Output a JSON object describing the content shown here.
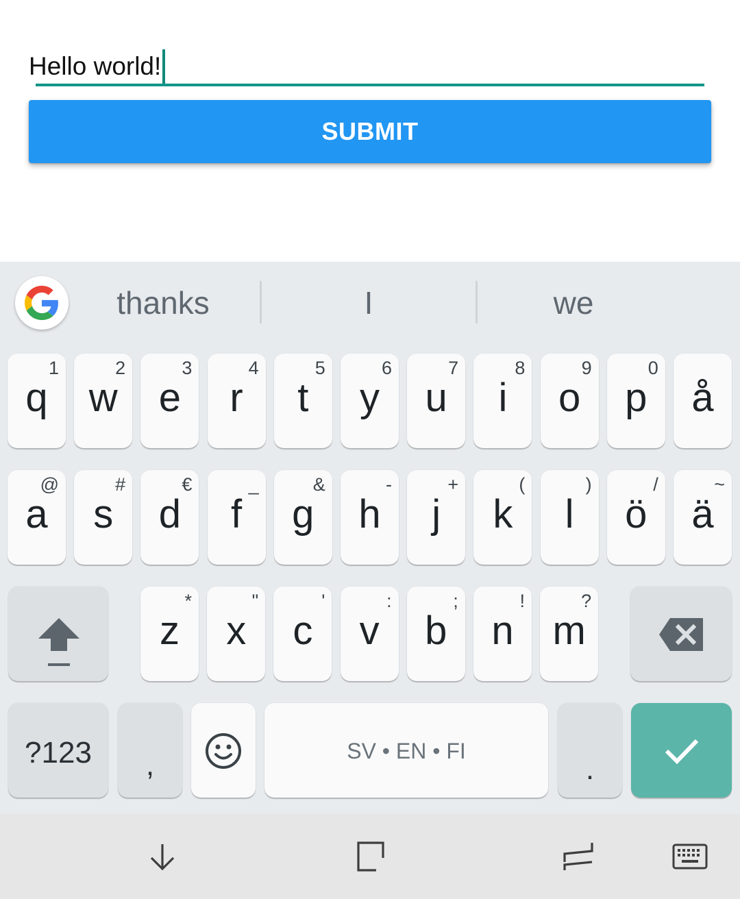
{
  "app": {
    "input_value": "Hello world!",
    "submit_label": "SUBMIT"
  },
  "keyboard": {
    "suggestions": [
      "thanks",
      "I",
      "we"
    ],
    "row1": [
      {
        "key": "q",
        "hint": "1"
      },
      {
        "key": "w",
        "hint": "2"
      },
      {
        "key": "e",
        "hint": "3"
      },
      {
        "key": "r",
        "hint": "4"
      },
      {
        "key": "t",
        "hint": "5"
      },
      {
        "key": "y",
        "hint": "6"
      },
      {
        "key": "u",
        "hint": "7"
      },
      {
        "key": "i",
        "hint": "8"
      },
      {
        "key": "o",
        "hint": "9"
      },
      {
        "key": "p",
        "hint": "0"
      },
      {
        "key": "å",
        "hint": ""
      }
    ],
    "row2": [
      {
        "key": "a",
        "hint": "@"
      },
      {
        "key": "s",
        "hint": "#"
      },
      {
        "key": "d",
        "hint": "€"
      },
      {
        "key": "f",
        "hint": "_"
      },
      {
        "key": "g",
        "hint": "&"
      },
      {
        "key": "h",
        "hint": "-"
      },
      {
        "key": "j",
        "hint": "+"
      },
      {
        "key": "k",
        "hint": "("
      },
      {
        "key": "l",
        "hint": ")"
      },
      {
        "key": "ö",
        "hint": "/"
      },
      {
        "key": "ä",
        "hint": "~"
      }
    ],
    "row3": [
      {
        "key": "z",
        "hint": "*"
      },
      {
        "key": "x",
        "hint": "\""
      },
      {
        "key": "c",
        "hint": "'"
      },
      {
        "key": "v",
        "hint": ":"
      },
      {
        "key": "b",
        "hint": ";"
      },
      {
        "key": "n",
        "hint": "!"
      },
      {
        "key": "m",
        "hint": "?"
      }
    ],
    "symbols_label": "?123",
    "comma": ",",
    "period": ".",
    "space_label": "SV • EN • FI",
    "icons": {
      "shift": "shift-icon",
      "backspace": "backspace-icon",
      "emoji": "emoji-icon",
      "enter": "checkmark-icon",
      "google": "google-g-icon"
    },
    "colors": {
      "accent_enter": "#5bb5a9",
      "background": "#e8ebee"
    }
  },
  "app_colors": {
    "submit": "#2196f3",
    "underline": "#139688"
  },
  "navbar": {
    "icons": [
      "hide-keyboard-icon",
      "recents-icon",
      "back-icon",
      "keyboard-switch-icon"
    ]
  }
}
